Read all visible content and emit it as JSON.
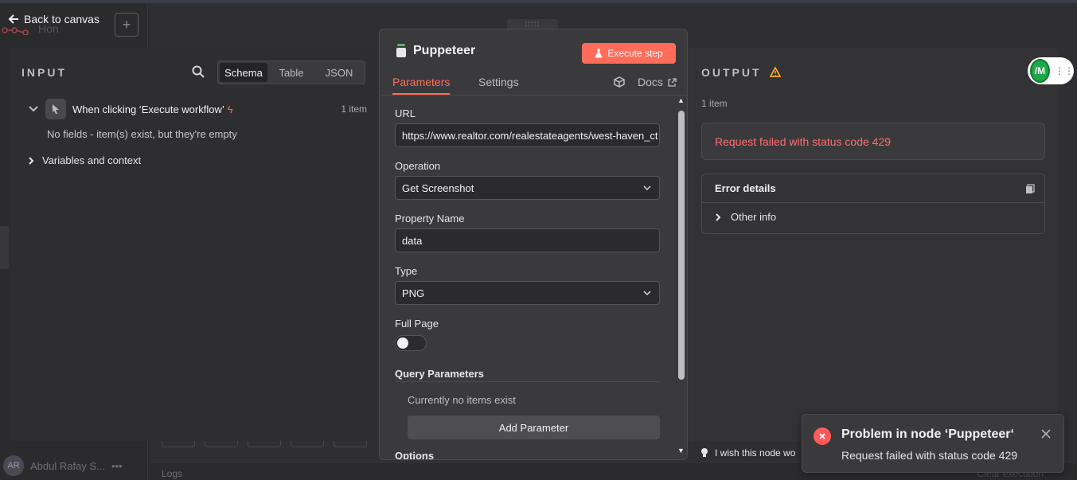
{
  "background": {
    "flow_name": "Hon",
    "user_name": "Abdul Rafay S...",
    "user_initials": "AR",
    "logs_label": "Logs",
    "clear_execution_label": "Clear execution"
  },
  "nav": {
    "back_label": "Back to canvas"
  },
  "input_panel": {
    "title": "INPUT",
    "view_tabs": [
      "Schema",
      "Table",
      "JSON"
    ],
    "active_view": "Schema",
    "trigger_label": "When clicking ‘Execute workflow’",
    "trigger_count": "1 item",
    "empty_message": "No fields - item(s) exist, but they're empty",
    "variables_label": "Variables and context"
  },
  "node_panel": {
    "drag_handle": ":::::",
    "title": "Puppeteer",
    "execute_label": "Execute step",
    "tabs": [
      "Parameters",
      "Settings"
    ],
    "active_tab": "Parameters",
    "docs_label": "Docs",
    "fields": {
      "url_label": "URL",
      "url_value": "https://www.realtor.com/realestateagents/west-haven_ct",
      "operation_label": "Operation",
      "operation_value": "Get Screenshot",
      "property_label": "Property Name",
      "property_value": "data",
      "type_label": "Type",
      "type_value": "PNG",
      "full_page_label": "Full Page",
      "full_page_on": false,
      "query_params_label": "Query Parameters",
      "no_items": "Currently no items exist",
      "add_param_label": "Add Parameter",
      "options_label": "Options"
    }
  },
  "output_panel": {
    "title": "OUTPUT",
    "count": "1 item",
    "error_message": "Request failed with status code 429",
    "details_title": "Error details",
    "other_info_label": "Other info",
    "avatar_initials": "/M",
    "feedback_text": "I wish this node wo"
  },
  "toast": {
    "title": "Problem in node ‘Puppeteer‘",
    "message": "Request failed with status code 429"
  },
  "colors": {
    "accent": "#ff6d5a",
    "error": "#ff5a5a",
    "panel": "#2e2e31"
  }
}
